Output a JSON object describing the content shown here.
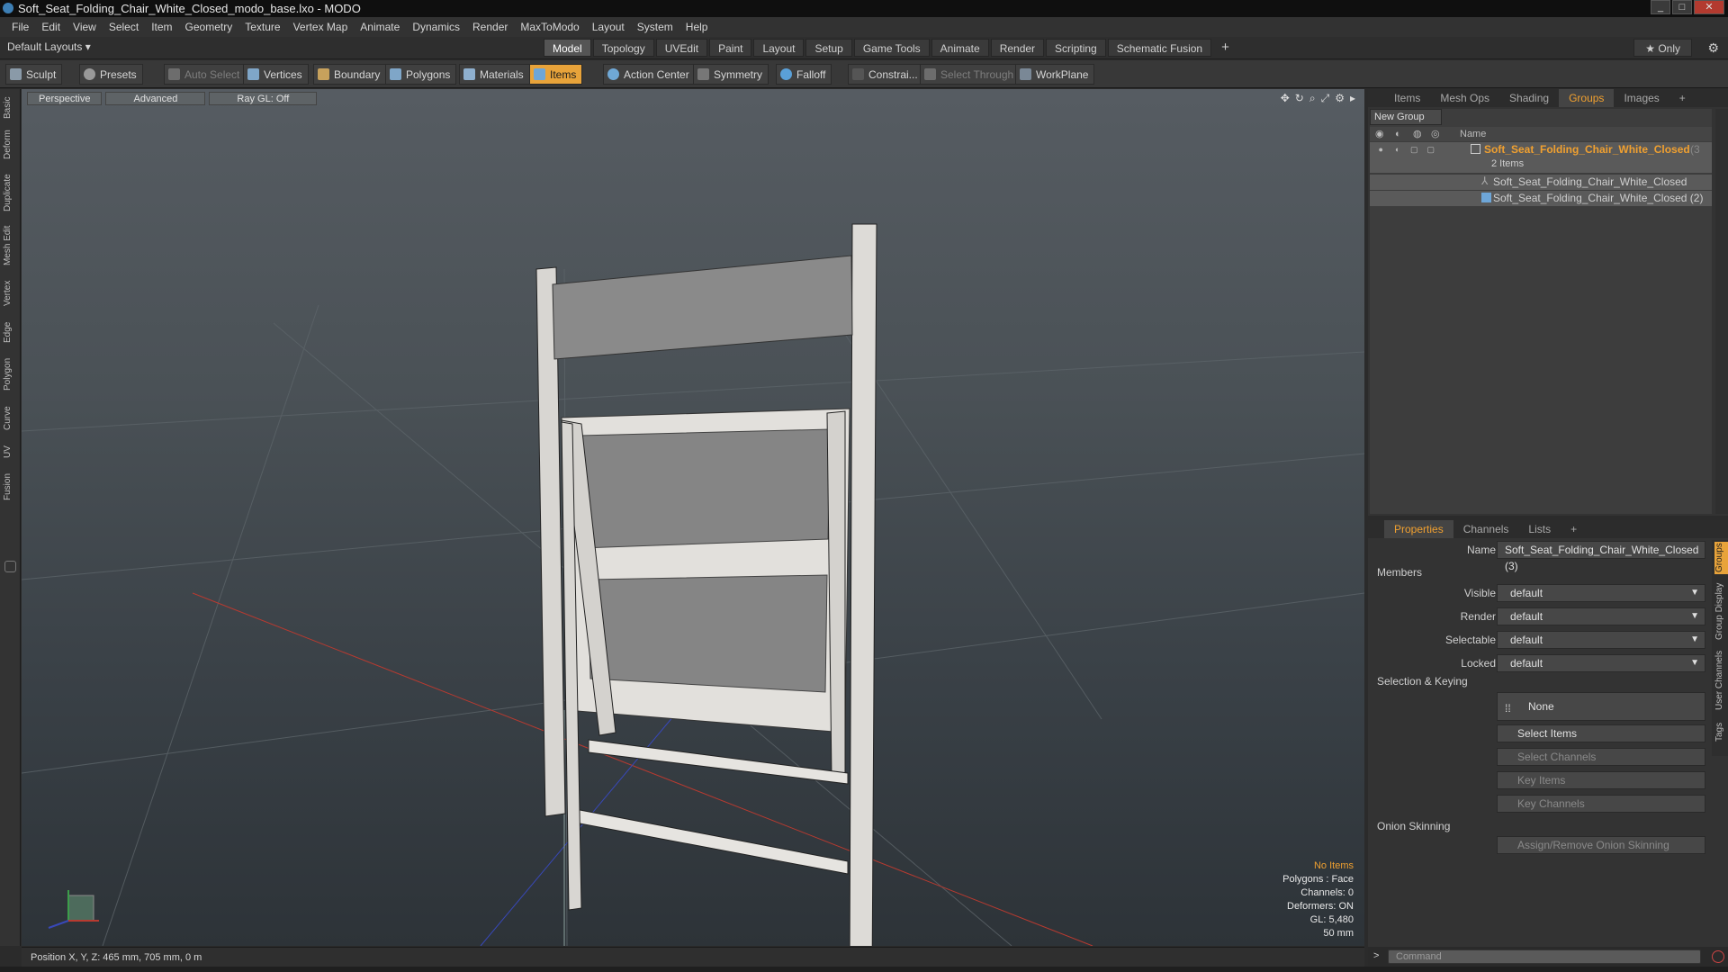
{
  "window": {
    "title": "Soft_Seat_Folding_Chair_White_Closed_modo_base.lxo - MODO"
  },
  "menu": [
    "File",
    "Edit",
    "View",
    "Select",
    "Item",
    "Geometry",
    "Texture",
    "Vertex Map",
    "Animate",
    "Dynamics",
    "Render",
    "MaxToModo",
    "Layout",
    "System",
    "Help"
  ],
  "layout": {
    "name": "Default Layouts ▾",
    "only_label": "★ Only"
  },
  "mode_tabs": [
    "Model",
    "Topology",
    "UVEdit",
    "Paint",
    "Layout",
    "Setup",
    "Game Tools",
    "Animate",
    "Render",
    "Scripting",
    "Schematic Fusion"
  ],
  "toolbar": {
    "sculpt": "Sculpt",
    "presets": "Presets",
    "auto_select": "Auto Select",
    "vertices": "Vertices",
    "boundary": "Boundary",
    "polygons": "Polygons",
    "materials": "Materials",
    "items": "Items",
    "action_center": "Action Center",
    "symmetry": "Symmetry",
    "falloff": "Falloff",
    "constraints": "Constrai...",
    "select_through": "Select Through",
    "workplane": "WorkPlane"
  },
  "left_tabs": [
    "Basic",
    "Deform",
    "Duplicate",
    "Mesh Edit",
    "Vertex",
    "Edge",
    "Polygon",
    "Curve",
    "UV",
    "Fusion"
  ],
  "viewport": {
    "view": "Perspective",
    "shading": "Advanced",
    "raygl": "Ray GL: Off",
    "stats": {
      "items": "No Items",
      "polygons": "Polygons : Face",
      "channels": "Channels: 0",
      "deformers": "Deformers: ON",
      "gl": "GL: 5,480",
      "size": "50 mm"
    }
  },
  "status": {
    "position": "Position X, Y, Z:  465 mm, 705 mm, 0 m"
  },
  "top_panel": {
    "tabs": [
      "Items",
      "Mesh Ops",
      "Shading",
      "Groups",
      "Images"
    ],
    "new_group": "New Group",
    "col_name": "Name",
    "group": {
      "name": "Soft_Seat_Folding_Chair_White_Closed",
      "suffix": "(3",
      "count": "2 Items"
    },
    "children": [
      "Soft_Seat_Folding_Chair_White_Closed",
      "Soft_Seat_Folding_Chair_White_Closed (2)"
    ]
  },
  "bottom_panel": {
    "tabs": [
      "Properties",
      "Channels",
      "Lists"
    ],
    "name_label": "Name",
    "name_value": "Soft_Seat_Folding_Chair_White_Closed (3)",
    "members": "Members",
    "visible_label": "Visible",
    "render_label": "Render",
    "selectable_label": "Selectable",
    "locked_label": "Locked",
    "default_value": "default",
    "sel_keying": "Selection & Keying",
    "none": "None",
    "select_items": "Select Items",
    "select_channels": "Select Channels",
    "key_items": "Key Items",
    "key_channels": "Key Channels",
    "onion": "Onion Skinning",
    "assign_onion": "Assign/Remove Onion Skinning",
    "side_tabs": [
      "Groups",
      "Group Display",
      "User Channels",
      "Tags"
    ]
  },
  "command": {
    "placeholder": "Command"
  },
  "colors": {
    "accent": "#f0a030",
    "items_button": "#e8a33a"
  }
}
